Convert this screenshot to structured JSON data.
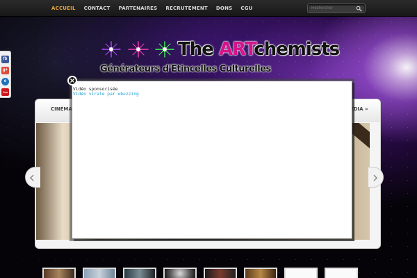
{
  "nav": {
    "items": [
      "ACCUEIL",
      "CONTACT",
      "PARTENAIRES",
      "RECRUTEMENT",
      "DONS",
      "CGU"
    ],
    "active": "ACCUEIL"
  },
  "search": {
    "placeholder": "Rechercher"
  },
  "logo": {
    "title_pre": "The ",
    "title_highlight": "ART",
    "title_post": "chemists",
    "subtitle": "Générateurs d'Etincelles Culturelles"
  },
  "social": [
    "facebook-icon",
    "google-plus-icon",
    "ie-icon",
    "youtube-icon"
  ],
  "categories": {
    "left": "CINÉMA »",
    "right": "MÉDIA »"
  },
  "modal": {
    "label": "Vidéo sponsorisée",
    "link": "Vidéo virale par ebuzzing"
  },
  "colors": {
    "accent": "#e8a53a",
    "highlight": "#d8128a",
    "link": "#1ea0d8"
  }
}
